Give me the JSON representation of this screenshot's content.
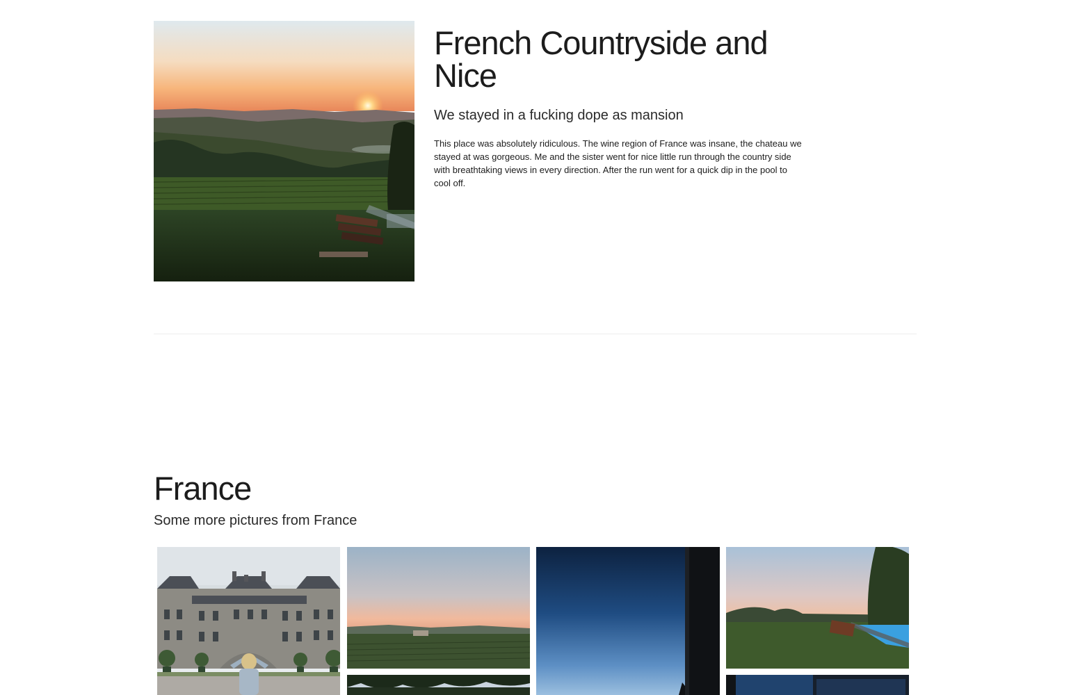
{
  "feature_post": {
    "title": "French Countryside and Nice",
    "subtitle": "We stayed in a fucking dope as mansion",
    "body": "This place was absolutely ridiculous. The wine region of France was insane, the chateau we stayed at was gorgeous. Me and the sister went for nice little run through the country side with breathtaking views in every direction. After the run went for a quick dip in the pool to cool off."
  },
  "gallery": {
    "title": "France",
    "subtitle": "Some more pictures from France"
  },
  "colors": {
    "text": "#1c1c1c",
    "divider": "#ececec",
    "background": "#ffffff"
  }
}
